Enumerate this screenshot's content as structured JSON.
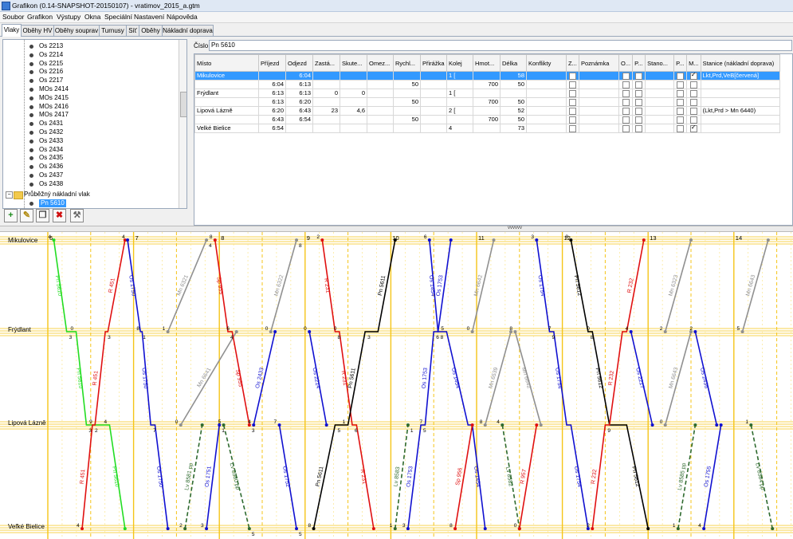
{
  "window": {
    "title": "Grafikon (0.14-SNAPSHOT-20150107) - vratimov_2015_a.gtm"
  },
  "menu": [
    "Soubor",
    "Grafikon",
    "Výstupy",
    "Okna",
    "Speciální",
    "Nastavení",
    "Nápověda"
  ],
  "tabs": [
    "Vlaky",
    "Oběhy HV",
    "Oběhy souprav",
    "Turnusy",
    "Síť",
    "Oběhy",
    "Nákladní doprava"
  ],
  "tree": {
    "items": [
      "Os 2213",
      "Os 2214",
      "Os 2215",
      "Os 2216",
      "Os 2217",
      "MOs 2414",
      "MOs 2415",
      "MOs 2416",
      "MOs 2417",
      "Os 2431",
      "Os 2432",
      "Os 2433",
      "Os 2434",
      "Os 2435",
      "Os 2436",
      "Os 2437",
      "Os 2438"
    ],
    "group": "Průběžný nákladní vlak",
    "selected": "Pn 5610"
  },
  "toolbar": {
    "add": "+",
    "edit": "✎",
    "copy": "❐",
    "delete": "✖",
    "tool": "⚒"
  },
  "detail": {
    "cislo_label": "Číslo:",
    "cislo_value": "Pn 5610",
    "columns": [
      "Místo",
      "Příjezd",
      "Odjezd",
      "Zastá...",
      "Skute...",
      "Omez...",
      "Rychl...",
      "Přirážka",
      "Kolej",
      "Hmot...",
      "Délka",
      "Konflikty",
      "Z...",
      "Poznámka",
      "O...",
      "P...",
      "Stano...",
      "P...",
      "M...",
      "Stanice (nákladní doprava)"
    ],
    "rows": [
      {
        "misto": "Mikulovice",
        "prijezd": "",
        "odjezd": "6:04",
        "zast": "",
        "skut": "",
        "omez": "",
        "rychl": "",
        "prir": "",
        "kolej": "1 [",
        "hmot": "",
        "delka": "58",
        "konf": "",
        "z": false,
        "pozn": "",
        "o": false,
        "p": false,
        "stano": "",
        "p2": false,
        "m": true,
        "stanice": "Lkt,Prd,VeB[červená]"
      },
      {
        "misto": "",
        "prijezd": "6:04",
        "odjezd": "6:13",
        "zast": "",
        "skut": "",
        "omez": "",
        "rychl": "50",
        "prir": "",
        "kolej": "",
        "hmot": "700",
        "delka": "50",
        "konf": "",
        "z": false,
        "pozn": "",
        "o": false,
        "p": false,
        "stano": "",
        "p2": false,
        "m": false,
        "stanice": ""
      },
      {
        "misto": "Frýdlant",
        "prijezd": "6:13",
        "odjezd": "6:13",
        "zast": "0",
        "skut": "0",
        "omez": "",
        "rychl": "",
        "prir": "",
        "kolej": "1 [",
        "hmot": "",
        "delka": "",
        "konf": "",
        "z": false,
        "pozn": "",
        "o": false,
        "p": false,
        "stano": "",
        "p2": false,
        "m": false,
        "stanice": ""
      },
      {
        "misto": "",
        "prijezd": "6:13",
        "odjezd": "6:20",
        "zast": "",
        "skut": "",
        "omez": "",
        "rychl": "50",
        "prir": "",
        "kolej": "",
        "hmot": "700",
        "delka": "50",
        "konf": "",
        "z": false,
        "pozn": "",
        "o": false,
        "p": false,
        "stano": "",
        "p2": false,
        "m": false,
        "stanice": ""
      },
      {
        "misto": "Lipová Lázně",
        "prijezd": "6:20",
        "odjezd": "6:43",
        "zast": "23",
        "skut": "4,6",
        "omez": "",
        "rychl": "",
        "prir": "",
        "kolej": "2 [",
        "hmot": "",
        "delka": "52",
        "konf": "",
        "z": false,
        "pozn": "",
        "o": false,
        "p": false,
        "stano": "",
        "p2": false,
        "m": false,
        "stanice": "(Lkt,Prd > Mn 6440)"
      },
      {
        "misto": "",
        "prijezd": "6:43",
        "odjezd": "6:54",
        "zast": "",
        "skut": "",
        "omez": "",
        "rychl": "50",
        "prir": "",
        "kolej": "",
        "hmot": "700",
        "delka": "50",
        "konf": "",
        "z": false,
        "pozn": "",
        "o": false,
        "p": false,
        "stano": "",
        "p2": false,
        "m": false,
        "stanice": ""
      },
      {
        "misto": "Velké Bielice",
        "prijezd": "6:54",
        "odjezd": "",
        "zast": "",
        "skut": "",
        "omez": "",
        "rychl": "",
        "prir": "",
        "kolej": "4",
        "hmot": "",
        "delka": "73",
        "konf": "",
        "z": false,
        "pozn": "",
        "o": false,
        "p": false,
        "stano": "",
        "p2": false,
        "m": true,
        "stanice": ""
      }
    ]
  },
  "splitter_mark": "vvvvvv",
  "graph": {
    "stations": [
      "Mikulovice",
      "Frýdlant",
      "Lipová Lázně",
      "Veľké Bielice"
    ],
    "hours": [
      "6",
      "7",
      "8",
      "9",
      "10",
      "11",
      "12",
      "13",
      "14"
    ],
    "colors": {
      "green": "#22dd22",
      "red": "#e01010",
      "blue": "#1010d0",
      "gray": "#909090",
      "black": "#000000",
      "darkgreen": "#2e6a2e",
      "grid": "#f5c518",
      "gridlight": "#fbe58a"
    },
    "trains": [
      {
        "label": "Pn 5610",
        "color": "green",
        "dash": false,
        "pts": [
          [
            6.07,
            0
          ],
          [
            6.22,
            1
          ],
          [
            6.33,
            1
          ],
          [
            6.45,
            2
          ],
          [
            6.72,
            2
          ],
          [
            6.9,
            3
          ]
        ],
        "lbls": [
          "Pn 5610",
          "Pn 5610",
          "Pn 5610"
        ],
        "nums": [
          "4",
          "3",
          "0",
          "3",
          "4"
        ]
      },
      {
        "label": "R 451",
        "color": "red",
        "dash": false,
        "pts": [
          [
            6.4,
            3
          ],
          [
            6.52,
            2
          ],
          [
            6.55,
            2
          ],
          [
            6.67,
            1
          ],
          [
            6.7,
            1
          ],
          [
            6.9,
            0
          ]
        ],
        "lbls": [
          "R 451",
          "R 451",
          "R 451"
        ],
        "nums": [
          "4",
          "2",
          "9",
          "3"
        ]
      },
      {
        "label": "Os 1750",
        "color": "blue",
        "dash": false,
        "pts": [
          [
            6.93,
            0
          ],
          [
            7.08,
            1
          ],
          [
            7.1,
            1
          ],
          [
            7.2,
            2
          ],
          [
            7.25,
            2
          ],
          [
            7.4,
            3
          ]
        ],
        "lbls": [
          "Os 1750",
          "Os 1750",
          "Os 1750"
        ],
        "nums": [
          "4",
          "1",
          "8",
          "7"
        ]
      },
      {
        "label": "Mn 6321",
        "color": "gray",
        "dash": false,
        "pts": [
          [
            7.4,
            1
          ],
          [
            7.85,
            0
          ]
        ],
        "lbls": [
          "Mn 6321"
        ],
        "nums": [
          "1",
          "4"
        ]
      },
      {
        "label": "Mn 6641",
        "color": "gray",
        "dash": false,
        "pts": [
          [
            7.55,
            2
          ],
          [
            8.2,
            1
          ]
        ],
        "lbls": [
          "Mn 6641"
        ],
        "nums": [
          "0"
        ]
      },
      {
        "label": "Lv 8581 pp",
        "color": "darkgreen",
        "dash": true,
        "pts": [
          [
            7.6,
            3
          ],
          [
            7.8,
            2
          ]
        ],
        "lbls": [
          "Lv 8581 pp"
        ],
        "nums": [
          "2"
        ]
      },
      {
        "label": "Os 1751",
        "color": "blue",
        "dash": false,
        "pts": [
          [
            7.85,
            3
          ],
          [
            8.0,
            2
          ]
        ],
        "lbls": [
          "Os 1751"
        ],
        "nums": [
          "3",
          "1"
        ]
      },
      {
        "label": "Sp 955",
        "color": "red",
        "dash": false,
        "pts": [
          [
            7.95,
            0
          ],
          [
            8.1,
            1
          ],
          [
            8.15,
            1
          ],
          [
            8.35,
            2
          ]
        ],
        "lbls": [
          "Sp 955",
          "Sp 955"
        ],
        "nums": [
          "8",
          "4",
          "6",
          "3"
        ]
      },
      {
        "label": "Lv 8580 pp",
        "color": "darkgreen",
        "dash": true,
        "pts": [
          [
            8.05,
            2
          ],
          [
            8.35,
            3
          ]
        ],
        "lbls": [
          "Lv 8580 pp"
        ],
        "nums": [
          "5",
          "5"
        ]
      },
      {
        "label": "Os 2433",
        "color": "blue",
        "dash": false,
        "pts": [
          [
            8.4,
            2
          ],
          [
            8.65,
            1
          ]
        ],
        "lbls": [
          "Os 2433"
        ],
        "nums": [
          "4"
        ]
      },
      {
        "label": "Mn 6322",
        "color": "gray",
        "dash": false,
        "pts": [
          [
            8.6,
            1
          ],
          [
            8.9,
            0
          ]
        ],
        "lbls": [
          "Mn 6322"
        ],
        "nums": [
          "0",
          "8"
        ]
      },
      {
        "label": "Os 1752",
        "color": "blue",
        "dash": false,
        "pts": [
          [
            8.7,
            2
          ],
          [
            8.9,
            3
          ]
        ],
        "lbls": [
          "Os 1752"
        ],
        "nums": [
          "7",
          "5"
        ]
      },
      {
        "label": "Os 2214",
        "color": "blue",
        "dash": false,
        "pts": [
          [
            9.05,
            1
          ],
          [
            9.25,
            2
          ]
        ],
        "lbls": [
          "Os 2214"
        ],
        "nums": [
          "0"
        ]
      },
      {
        "label": "R 231",
        "color": "red",
        "dash": false,
        "pts": [
          [
            9.2,
            0
          ],
          [
            9.35,
            1
          ],
          [
            9.4,
            1
          ],
          [
            9.55,
            2
          ],
          [
            9.6,
            2
          ],
          [
            9.8,
            3
          ]
        ],
        "lbls": [
          "R 231",
          "R 231",
          "R 231"
        ],
        "nums": [
          "2",
          "8",
          "0",
          "6"
        ]
      },
      {
        "label": "Pn 5611",
        "color": "black",
        "dash": false,
        "pts": [
          [
            9.1,
            3
          ],
          [
            9.35,
            2
          ],
          [
            9.5,
            2
          ],
          [
            9.7,
            1
          ],
          [
            9.85,
            1
          ],
          [
            10.05,
            0
          ]
        ],
        "lbls": [
          "Pn 5611",
          "Pn 5611",
          "Pn 5611"
        ],
        "nums": [
          "8",
          "5",
          "1",
          "3"
        ]
      },
      {
        "label": "Lv 8583",
        "color": "darkgreen",
        "dash": true,
        "pts": [
          [
            10.05,
            3
          ],
          [
            10.2,
            2
          ]
        ],
        "lbls": [
          "Lv 8583"
        ],
        "nums": [
          "1",
          "1"
        ]
      },
      {
        "label": "Os 1753",
        "color": "blue",
        "dash": false,
        "pts": [
          [
            10.2,
            3
          ],
          [
            10.35,
            2
          ],
          [
            10.4,
            2
          ],
          [
            10.5,
            1
          ],
          [
            10.55,
            1
          ],
          [
            10.7,
            0
          ]
        ],
        "lbls": [
          "Os 1753",
          "Os 1753",
          "Os 1753"
        ],
        "nums": [
          "3",
          "5",
          "7",
          "6"
        ]
      },
      {
        "label": "Os 1454",
        "color": "blue",
        "dash": false,
        "pts": [
          [
            10.45,
            0
          ],
          [
            10.55,
            1
          ],
          [
            10.65,
            1
          ],
          [
            10.9,
            2
          ],
          [
            10.95,
            2
          ],
          [
            11.1,
            3
          ]
        ],
        "lbls": [
          "Os 1454",
          "Os 1454",
          "Os 1454"
        ],
        "nums": [
          "6",
          "8",
          "5"
        ]
      },
      {
        "label": "Sp 956",
        "color": "red",
        "dash": false,
        "pts": [
          [
            10.75,
            3
          ],
          [
            10.95,
            2
          ]
        ],
        "lbls": [
          "Sp 956"
        ],
        "nums": [
          "8"
        ]
      },
      {
        "label": "Mn 6642",
        "color": "gray",
        "dash": false,
        "pts": [
          [
            10.95,
            1
          ],
          [
            11.2,
            0
          ]
        ],
        "lbls": [
          "Mn 6642"
        ],
        "nums": [
          "0"
        ]
      },
      {
        "label": "Mn 6539",
        "color": "gray",
        "dash": false,
        "pts": [
          [
            11.1,
            2
          ],
          [
            11.4,
            1
          ]
        ],
        "lbls": [
          "Mn 6539"
        ],
        "nums": [
          "8"
        ]
      },
      {
        "label": "Lv 8582",
        "color": "darkgreen",
        "dash": true,
        "pts": [
          [
            11.3,
            2
          ],
          [
            11.5,
            3
          ]
        ],
        "lbls": [
          "Lv 8582"
        ],
        "nums": [
          "4"
        ]
      },
      {
        "label": "Mn 6642",
        "color": "gray",
        "dash": false,
        "pts": [
          [
            11.45,
            1
          ],
          [
            11.75,
            2
          ]
        ],
        "lbls": [
          "Mn 6642"
        ],
        "nums": [
          "8"
        ]
      },
      {
        "label": "R 957",
        "color": "red",
        "dash": false,
        "pts": [
          [
            11.5,
            3
          ],
          [
            11.7,
            2
          ]
        ],
        "lbls": [
          "R 957"
        ],
        "nums": [
          "0"
        ]
      },
      {
        "label": "Os 1754",
        "color": "blue",
        "dash": false,
        "pts": [
          [
            11.7,
            0
          ],
          [
            11.85,
            1
          ],
          [
            11.9,
            1
          ],
          [
            12.05,
            2
          ],
          [
            12.1,
            2
          ],
          [
            12.3,
            3
          ]
        ],
        "lbls": [
          "Os 1754",
          "Os 1754",
          "Os 1754"
        ],
        "nums": [
          "3",
          "9",
          "7"
        ]
      },
      {
        "label": "Pn 5612",
        "color": "black",
        "dash": false,
        "pts": [
          [
            12.1,
            0
          ],
          [
            12.3,
            1
          ],
          [
            12.35,
            1
          ],
          [
            12.55,
            2
          ],
          [
            12.75,
            2
          ],
          [
            13.0,
            3
          ]
        ],
        "lbls": [
          "Pn 5612",
          "Pn 5612",
          "Pn 5612"
        ],
        "nums": [
          "8",
          "8",
          "0"
        ]
      },
      {
        "label": "R 232",
        "color": "red",
        "dash": false,
        "pts": [
          [
            12.35,
            3
          ],
          [
            12.5,
            2
          ],
          [
            12.55,
            2
          ],
          [
            12.7,
            1
          ],
          [
            12.75,
            1
          ],
          [
            12.95,
            0
          ]
        ],
        "lbls": [
          "R 232",
          "R 232",
          "R 232"
        ],
        "nums": [
          "2",
          "9"
        ]
      },
      {
        "label": "Os 2217",
        "color": "blue",
        "dash": false,
        "pts": [
          [
            12.8,
            1
          ],
          [
            13.05,
            2
          ]
        ],
        "lbls": [
          "Os 2217"
        ],
        "nums": [
          "4"
        ]
      },
      {
        "label": "Mn 6323",
        "color": "gray",
        "dash": false,
        "pts": [
          [
            13.2,
            1
          ],
          [
            13.5,
            0
          ]
        ],
        "lbls": [
          "Mn 6323"
        ],
        "nums": [
          "2"
        ]
      },
      {
        "label": "Mn 6643",
        "color": "gray",
        "dash": false,
        "pts": [
          [
            13.2,
            2
          ],
          [
            13.5,
            1
          ]
        ],
        "lbls": [
          "Mn 6643"
        ],
        "nums": [
          "0"
        ]
      },
      {
        "label": "Os 2436",
        "color": "blue",
        "dash": false,
        "pts": [
          [
            13.55,
            1
          ],
          [
            13.8,
            2
          ]
        ],
        "lbls": [
          "Os 2436"
        ],
        "nums": [
          "2"
        ]
      },
      {
        "label": "Lv 8585 pp",
        "color": "darkgreen",
        "dash": true,
        "pts": [
          [
            13.35,
            3
          ],
          [
            13.55,
            2
          ]
        ],
        "lbls": [
          "Lv 8585 pp"
        ],
        "nums": [
          "1"
        ]
      },
      {
        "label": "Os 1755",
        "color": "blue",
        "dash": false,
        "pts": [
          [
            13.65,
            3
          ],
          [
            13.85,
            2
          ]
        ],
        "lbls": [
          "Os 1755"
        ],
        "nums": [
          "4"
        ]
      },
      {
        "label": "Mn 6643",
        "color": "gray",
        "dash": false,
        "pts": [
          [
            14.1,
            1
          ],
          [
            14.4,
            0
          ]
        ],
        "lbls": [
          "Mn 6643"
        ],
        "nums": [
          "5"
        ]
      },
      {
        "label": "Lv 8584 pp",
        "color": "darkgreen",
        "dash": true,
        "pts": [
          [
            14.2,
            2
          ],
          [
            14.45,
            3
          ]
        ],
        "lbls": [
          "Lv 8584 pp"
        ],
        "nums": [
          "1"
        ]
      }
    ]
  }
}
